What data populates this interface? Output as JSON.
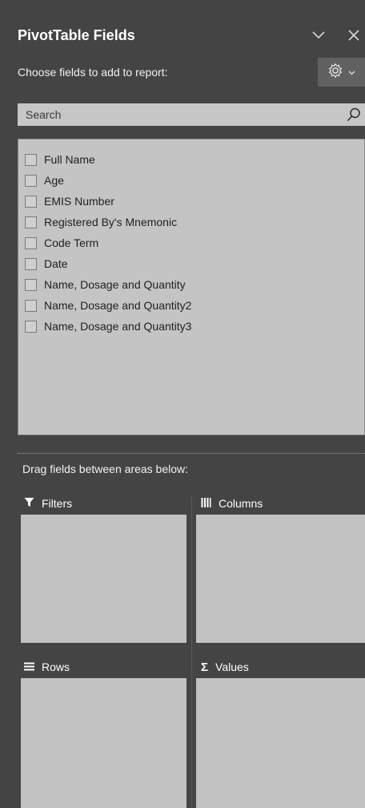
{
  "pane": {
    "title": "PivotTable Fields",
    "subtitle": "Choose fields to add to report:",
    "collapse_icon": "chevron-down-icon",
    "close_icon": "close-icon",
    "tools_icon": "gear-icon"
  },
  "search": {
    "placeholder": "Search",
    "value": ""
  },
  "fields": [
    {
      "label": "Full Name",
      "checked": false
    },
    {
      "label": "Age",
      "checked": false
    },
    {
      "label": "EMIS Number",
      "checked": false
    },
    {
      "label": "Registered By's Mnemonic",
      "checked": false
    },
    {
      "label": "Code Term",
      "checked": false
    },
    {
      "label": "Date",
      "checked": false
    },
    {
      "label": "Name, Dosage and Quantity",
      "checked": false
    },
    {
      "label": "Name, Dosage and Quantity2",
      "checked": false
    },
    {
      "label": "Name, Dosage and Quantity3",
      "checked": false
    }
  ],
  "areas": {
    "drag_label": "Drag fields between areas below:",
    "filters": {
      "label": "Filters",
      "icon": "filter-icon"
    },
    "columns": {
      "label": "Columns",
      "icon": "columns-icon"
    },
    "rows": {
      "label": "Rows",
      "icon": "rows-icon"
    },
    "values": {
      "label": "Values",
      "icon": "sigma-icon"
    }
  },
  "colors": {
    "background": "#444444",
    "list_background": "#c4c4c4",
    "area_background": "#c2c2c2",
    "search_background": "#c6c6c6"
  }
}
